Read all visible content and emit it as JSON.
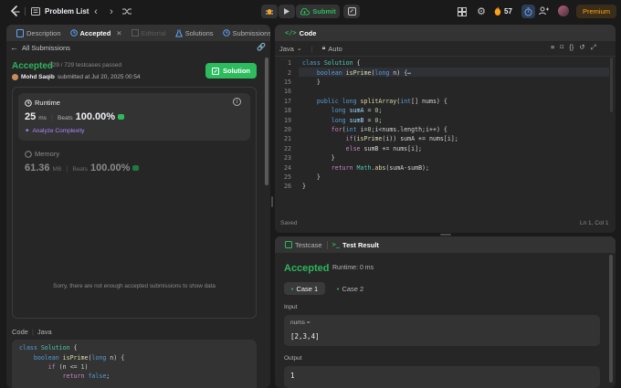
{
  "topbar": {
    "problem_list": "Problem List",
    "submit": "Submit",
    "streak": "57",
    "premium": "Premium"
  },
  "left_tabs": [
    "Description",
    "Accepted",
    "Editorial",
    "Solutions",
    "Submissions"
  ],
  "submission": {
    "back": "All Submissions",
    "status": "Accepted",
    "testcases": "729 / 729 testcases passed",
    "user": "Mohd Saqib",
    "submitted": "submitted at Jul 20, 2025 00:54",
    "solution_btn": "Solution"
  },
  "runtime": {
    "label": "Runtime",
    "value": "25",
    "unit": "ms",
    "beats_label": "Beats",
    "beats": "100.00%",
    "analyze": "Analyze Complexity"
  },
  "memory": {
    "label": "Memory",
    "value": "61.36",
    "unit": "MB",
    "beats_label": "Beats",
    "beats": "100.00%"
  },
  "no_data": "Sorry, there are not enough accepted submissions to show data",
  "left_code": {
    "label": "Code",
    "lang": "Java",
    "lines": [
      [
        {
          "t": "class ",
          "c": "kw"
        },
        {
          "t": "Solution",
          "c": "ty"
        },
        {
          "t": " {",
          "c": "tx"
        }
      ],
      [
        {
          "t": "    boolean ",
          "c": "kw"
        },
        {
          "t": "isPrime",
          "c": "fn"
        },
        {
          "t": "(",
          "c": "tx"
        },
        {
          "t": "long",
          "c": "kw"
        },
        {
          "t": " n) {",
          "c": "tx"
        }
      ],
      [
        {
          "t": "        if",
          "c": "ctl"
        },
        {
          "t": " (n <= ",
          "c": "tx"
        },
        {
          "t": "1",
          "c": "nm"
        },
        {
          "t": ")",
          "c": "tx"
        }
      ],
      [
        {
          "t": "            return ",
          "c": "ctl"
        },
        {
          "t": "false",
          "c": "kw"
        },
        {
          "t": ";",
          "c": "tx"
        }
      ]
    ]
  },
  "editor": {
    "title": "Code",
    "lang": "Java",
    "mode": "Auto",
    "saved": "Saved",
    "position": "Ln 1, Col 1",
    "lines": [
      {
        "n": "1",
        "seg": [
          {
            "t": "class ",
            "c": "kw"
          },
          {
            "t": "Solution",
            "c": "ty"
          },
          {
            "t": " {",
            "c": "tx"
          }
        ]
      },
      {
        "n": "2",
        "seg": [
          {
            "t": "    boolean ",
            "c": "kw"
          },
          {
            "t": "isPrime",
            "c": "fn"
          },
          {
            "t": "(",
            "c": "tx"
          },
          {
            "t": "long",
            "c": "kw"
          },
          {
            "t": " n) {",
            "c": "tx"
          },
          {
            "t": "↔",
            "c": "id"
          }
        ]
      },
      {
        "n": "15",
        "seg": [
          {
            "t": "    }",
            "c": "tx"
          }
        ]
      },
      {
        "n": "16",
        "seg": []
      },
      {
        "n": "17",
        "seg": [
          {
            "t": "    public long ",
            "c": "kw"
          },
          {
            "t": "splitArray",
            "c": "fn"
          },
          {
            "t": "(",
            "c": "tx"
          },
          {
            "t": "int",
            "c": "kw"
          },
          {
            "t": "[] nums) {",
            "c": "tx"
          }
        ]
      },
      {
        "n": "18",
        "seg": [
          {
            "t": "        long ",
            "c": "kw"
          },
          {
            "t": "sumA",
            "c": "id"
          },
          {
            "t": " = ",
            "c": "tx"
          },
          {
            "t": "0",
            "c": "nm"
          },
          {
            "t": ";",
            "c": "tx"
          }
        ]
      },
      {
        "n": "19",
        "seg": [
          {
            "t": "        long ",
            "c": "kw"
          },
          {
            "t": "sumB",
            "c": "id"
          },
          {
            "t": " = ",
            "c": "tx"
          },
          {
            "t": "0",
            "c": "nm"
          },
          {
            "t": ";",
            "c": "tx"
          }
        ]
      },
      {
        "n": "20",
        "seg": [
          {
            "t": "        for",
            "c": "ctl"
          },
          {
            "t": "(",
            "c": "tx"
          },
          {
            "t": "int",
            "c": "kw"
          },
          {
            "t": " i=",
            "c": "tx"
          },
          {
            "t": "0",
            "c": "nm"
          },
          {
            "t": ";i<nums.length;i++) {",
            "c": "tx"
          }
        ]
      },
      {
        "n": "21",
        "seg": [
          {
            "t": "            if",
            "c": "ctl"
          },
          {
            "t": "(",
            "c": "tx"
          },
          {
            "t": "isPrime",
            "c": "fn"
          },
          {
            "t": "(i)) sumA += nums[i];",
            "c": "tx"
          }
        ]
      },
      {
        "n": "22",
        "seg": [
          {
            "t": "            else",
            "c": "ctl"
          },
          {
            "t": " sumB += nums[i];",
            "c": "tx"
          }
        ]
      },
      {
        "n": "23",
        "seg": [
          {
            "t": "        }",
            "c": "tx"
          }
        ]
      },
      {
        "n": "24",
        "seg": [
          {
            "t": "        return ",
            "c": "ctl"
          },
          {
            "t": "Math",
            "c": "ty"
          },
          {
            "t": ".",
            "c": "tx"
          },
          {
            "t": "abs",
            "c": "fn"
          },
          {
            "t": "(sumA-sumB);",
            "c": "tx"
          }
        ]
      },
      {
        "n": "25",
        "seg": [
          {
            "t": "    }",
            "c": "tx"
          }
        ]
      },
      {
        "n": "26",
        "seg": [
          {
            "t": "}",
            "c": "tx"
          }
        ]
      }
    ]
  },
  "testpanel": {
    "tab1": "Testcase",
    "tab2": "Test Result",
    "status": "Accepted",
    "runtime": "Runtime: 0 ms",
    "case1": "Case 1",
    "case2": "Case 2",
    "input_label": "Input",
    "param": "nums =",
    "param_value": "[2,3,4]",
    "output_label": "Output",
    "output_value": "1"
  },
  "colors": {
    "accent_green": "#2cbb5d",
    "accepted": "#2db55d",
    "premium": "#ffa116",
    "blue": "#3b82f6"
  }
}
